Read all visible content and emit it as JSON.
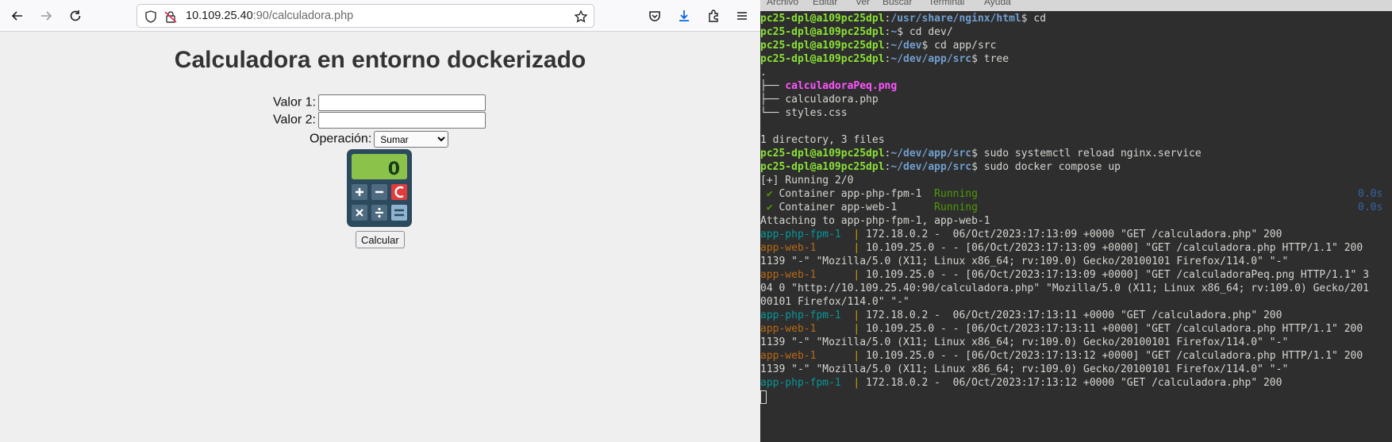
{
  "browser": {
    "url_host": "10.109.25.40",
    "url_rest": ":90/calculadora.php",
    "page": {
      "title": "Calculadora en entorno dockerizado",
      "valor1_label": "Valor 1:",
      "valor1_value": "",
      "valor2_label": "Valor 2:",
      "valor2_value": "",
      "operacion_label": "Operación:",
      "operacion_selected": "Sumar",
      "calculator_display": "0",
      "calcular_label": "Calcular"
    }
  },
  "terminal": {
    "menu": [
      "Archivo",
      "Editar",
      "Ver",
      "Buscar",
      "Terminal",
      "Ayuda"
    ],
    "prompt_user": "pc25-dpl@a109pc25dpl",
    "lines": {
      "l1_path": "/usr/share/nginx/html",
      "l1_cmd": "cd",
      "l2_path": "~",
      "l2_cmd": "cd dev/",
      "l3_path": "~/dev",
      "l3_cmd": "cd app/src",
      "l4_path": "~/dev/app/src",
      "l4_cmd": "tree",
      "tree_dot": ".",
      "tree1_prefix": "├── ",
      "tree1_name": "calculadoraPeq.png",
      "tree2_prefix": "├── ",
      "tree2_name": "calculadora.php",
      "tree3_prefix": "└── ",
      "tree3_name": "styles.css",
      "summary": "1 directory, 3 files",
      "l5_path": "~/dev/app/src",
      "l5_cmd": "sudo systemctl reload nginx.service",
      "l6_path": "~/dev/app/src",
      "l6_cmd": "sudo docker compose up",
      "running": "[+] Running 2/0",
      "c1_check": " ✔",
      "c1_name": " Container app-php-fpm-1  ",
      "c1_status": "Running",
      "c1_time": "0.0s",
      "c2_check": " ✔",
      "c2_name": " Container app-web-1      ",
      "c2_status": "Running",
      "c2_time": "0.0s",
      "attaching": "Attaching to app-php-fpm-1, app-web-1",
      "log1_src": "app-php-fpm-1  ",
      "log1_text": " 172.18.0.2 -  06/Oct/2023:17:13:09 +0000 \"GET /calculadora.php\" 200",
      "log2_src": "app-web-1      ",
      "log2_text": " 10.109.25.0 - - [06/Oct/2023:17:13:09 +0000] \"GET /calculadora.php HTTP/1.1\" 200",
      "log2_cont": "1139 \"-\" \"Mozilla/5.0 (X11; Linux x86_64; rv:109.0) Gecko/20100101 Firefox/114.0\" \"-\"",
      "log3_src": "app-web-1      ",
      "log3_text": " 10.109.25.0 - - [06/Oct/2023:17:13:09 +0000] \"GET /calculadoraPeq.png HTTP/1.1\" 3",
      "log3_cont1": "04 0 \"http://10.109.25.40:90/calculadora.php\" \"Mozilla/5.0 (X11; Linux x86_64; rv:109.0) Gecko/201",
      "log3_cont2": "00101 Firefox/114.0\" \"-\"",
      "log4_src": "app-php-fpm-1  ",
      "log4_text": " 172.18.0.2 -  06/Oct/2023:17:13:11 +0000 \"GET /calculadora.php\" 200",
      "log5_src": "app-web-1      ",
      "log5_text": " 10.109.25.0 - - [06/Oct/2023:17:13:11 +0000] \"GET /calculadora.php HTTP/1.1\" 200",
      "log5_cont": "1139 \"-\" \"Mozilla/5.0 (X11; Linux x86_64; rv:109.0) Gecko/20100101 Firefox/114.0\" \"-\"",
      "log6_src": "app-web-1      ",
      "log6_text": " 10.109.25.0 - - [06/Oct/2023:17:13:12 +0000] \"GET /calculadora.php HTTP/1.1\" 200",
      "log6_cont": "1139 \"-\" \"Mozilla/5.0 (X11; Linux x86_64; rv:109.0) Gecko/20100101 Firefox/114.0\" \"-\"",
      "log7_src": "app-php-fpm-1  ",
      "log7_text": " 172.18.0.2 -  06/Oct/2023:17:13:12 +0000 \"GET /calculadora.php\" 200",
      "pipe": "|",
      "colon": ":",
      "dollar": "$ "
    }
  },
  "colors": {
    "prompt_user": "#8ae234",
    "prompt_path": "#729fcf",
    "png_file": "#ff55ff",
    "running_status": "#4e9a06",
    "php_fpm_source": "#06989a",
    "web_source": "#b86a14",
    "terminal_bg": "#2e2e2e",
    "browser_bg": "#efefef"
  }
}
